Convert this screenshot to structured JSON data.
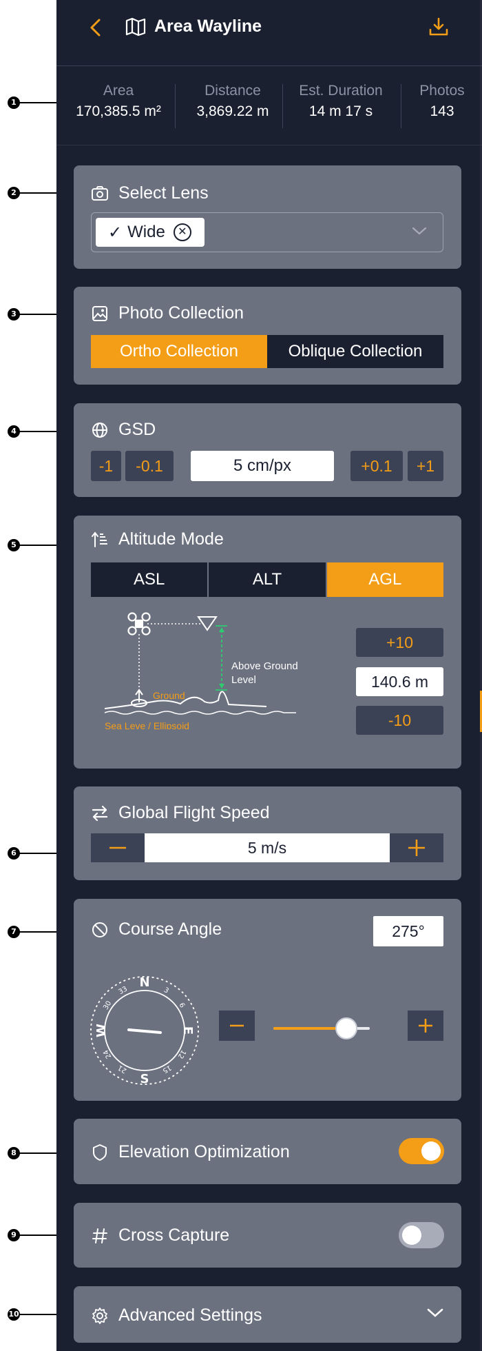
{
  "callouts": [
    "1",
    "2",
    "3",
    "4",
    "5",
    "6",
    "7",
    "8",
    "9",
    "10"
  ],
  "header": {
    "title": "Area Wayline",
    "back_icon": "chevron-left-icon",
    "map_icon": "map-icon",
    "download_icon": "download-icon"
  },
  "stats": [
    {
      "label": "Area",
      "value": "170,385.5 m²"
    },
    {
      "label": "Distance",
      "value": "3,869.22 m"
    },
    {
      "label": "Est. Duration",
      "value": "14 m 17 s"
    },
    {
      "label": "Photos",
      "value": "143"
    }
  ],
  "lens": {
    "title": "Select Lens",
    "chip": "Wide",
    "chip_check": "✓",
    "chip_clear": "✕"
  },
  "photo": {
    "title": "Photo Collection",
    "options": [
      "Ortho Collection",
      "Oblique Collection"
    ],
    "selected": "Ortho Collection"
  },
  "gsd": {
    "title": "GSD",
    "value": "5 cm/px",
    "dec1": "-1",
    "dec01": "-0.1",
    "inc01": "+0.1",
    "inc1": "+1"
  },
  "altitude": {
    "title": "Altitude Mode",
    "options": [
      "ASL",
      "ALT",
      "AGL"
    ],
    "selected": "AGL",
    "value": "140.6 m",
    "plus": "+10",
    "minus": "-10",
    "diagram": {
      "agl_line1": "Above Ground",
      "agl_line2": "Level",
      "ground": "Ground",
      "sea": "Sea Leve / Ellipsoid"
    }
  },
  "speed": {
    "title": "Global Flight Speed",
    "value": "5 m/s"
  },
  "course": {
    "title": "Course Angle",
    "value": "275°",
    "slider_fraction": 0.76,
    "compass": {
      "n": "N",
      "e": "E",
      "s": "S",
      "w": "W",
      "t3": "3",
      "t6": "6",
      "t12": "12",
      "t15": "15",
      "t21": "21",
      "t24": "24",
      "t30": "30",
      "t33": "33"
    }
  },
  "elevation": {
    "title": "Elevation Optimization",
    "enabled": true
  },
  "cross": {
    "title": "Cross Capture",
    "enabled": false
  },
  "advanced": {
    "title": "Advanced Settings"
  },
  "colors": {
    "accent": "#f49d16",
    "panel": "#1b2030",
    "card": "#6c7180",
    "button": "#3b4256",
    "agl_green": "#2ecc71"
  }
}
